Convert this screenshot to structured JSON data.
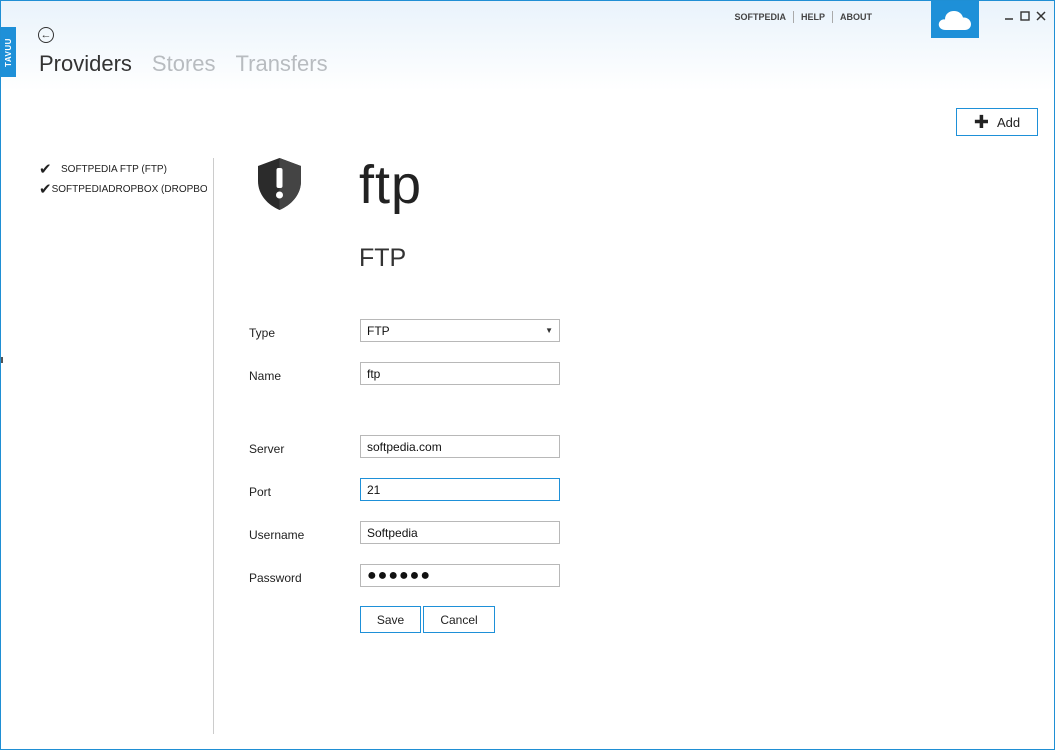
{
  "sidebar_tab": {
    "label": "TAVUU"
  },
  "nav": {
    "tabs": [
      {
        "label": "Providers"
      },
      {
        "label": "Stores"
      },
      {
        "label": "Transfers"
      }
    ]
  },
  "top_links": [
    {
      "label": "SOFTPEDIA"
    },
    {
      "label": "HELP"
    },
    {
      "label": "ABOUT"
    }
  ],
  "toolbar": {
    "add_label": "Add"
  },
  "providers": [
    {
      "label": "SOFTPEDIA FTP (FTP)"
    },
    {
      "label": "SOFTPEDIADROPBOX (DROPBOX)"
    }
  ],
  "provider_panel": {
    "logo_text": "ftp",
    "title": "FTP"
  },
  "form": {
    "type": {
      "label": "Type",
      "value": "FTP"
    },
    "name": {
      "label": "Name",
      "value": "ftp"
    },
    "server": {
      "label": "Server",
      "value": "softpedia.com"
    },
    "port": {
      "label": "Port",
      "value": "21"
    },
    "username": {
      "label": "Username",
      "value": "Softpedia"
    },
    "password": {
      "label": "Password",
      "value": "●●●●●●"
    },
    "save_label": "Save",
    "cancel_label": "Cancel"
  },
  "colors": {
    "accent": "#1e90d8",
    "inactive_tab": "#b8bcc0"
  }
}
